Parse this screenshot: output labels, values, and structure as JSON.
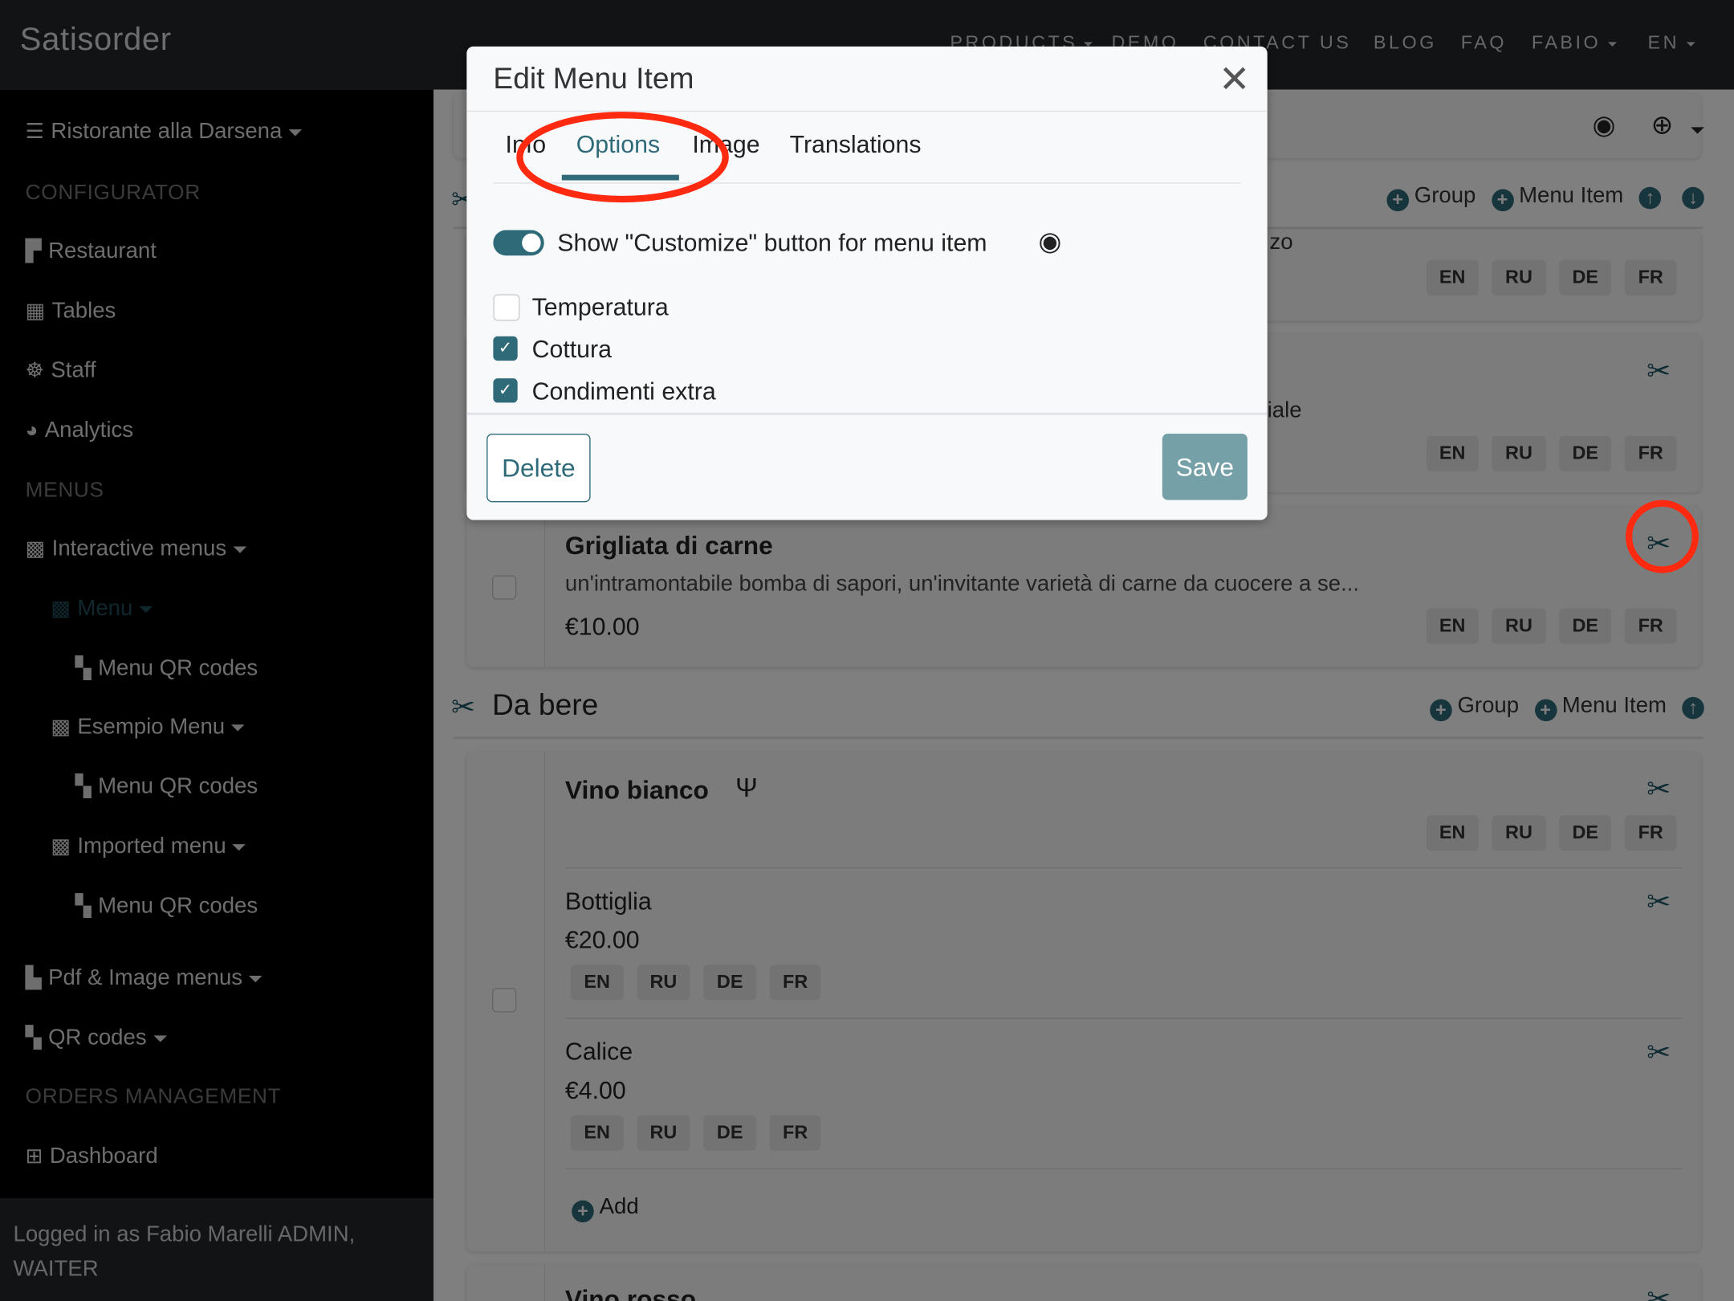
{
  "app": {
    "brand": "Satisorder"
  },
  "topnav": [
    {
      "label": "PRODUCTS",
      "dropdown": true
    },
    {
      "label": "DEMO"
    },
    {
      "label": "CONTACT US"
    },
    {
      "label": "BLOG"
    },
    {
      "label": "FAQ"
    },
    {
      "label": "FABIO",
      "dropdown": true
    },
    {
      "label": "EN",
      "dropdown": true
    }
  ],
  "sidebar": {
    "restaurant": "Ristorante alla Darsena",
    "configurator": "CONFIGURATOR",
    "config_items": [
      "Restaurant",
      "Tables",
      "Staff",
      "Analytics"
    ],
    "menus_heading": "MENUS",
    "interactive": "Interactive menus",
    "menu_active": "Menu",
    "qr": "Menu QR codes",
    "esempio": "Esempio Menu",
    "imported": "Imported menu",
    "pdf": "Pdf & Image menus",
    "qrcodes": "QR codes",
    "orders_heading": "ORDERS MANAGEMENT",
    "dashboard": "Dashboard",
    "footer": "Logged in as Fabio Marelli  ADMIN, WAITER"
  },
  "main": {
    "group_label": "Group",
    "menu_item_label": "Menu Item",
    "langs": [
      "EN",
      "RU",
      "DE",
      "FR"
    ],
    "partial1": "zo",
    "partial2": "iale",
    "grigliata": {
      "name": "Grigliata di carne",
      "desc": "un'intramontabile bomba di sapori, un'invitante varietà di carne da cuocere a se...",
      "price": "€10.00"
    },
    "section2": "Da bere",
    "vino": "Vino bianco",
    "variants": [
      {
        "name": "Bottiglia",
        "price": "€20.00"
      },
      {
        "name": "Calice",
        "price": "€4.00"
      }
    ],
    "add": "Add",
    "next": "Vino rosso"
  },
  "modal": {
    "title": "Edit Menu Item",
    "tabs": [
      "Info",
      "Options",
      "Image",
      "Translations"
    ],
    "active_tab": "Options",
    "toggle_label": "Show \"Customize\" button for menu item",
    "toggle_on": true,
    "options": [
      {
        "label": "Temperatura",
        "checked": false
      },
      {
        "label": "Cottura",
        "checked": true
      },
      {
        "label": "Condimenti extra",
        "checked": true
      }
    ],
    "delete": "Delete",
    "save": "Save"
  },
  "colors": {
    "accent": "#2e6a78",
    "annotation": "#ff2a10"
  }
}
